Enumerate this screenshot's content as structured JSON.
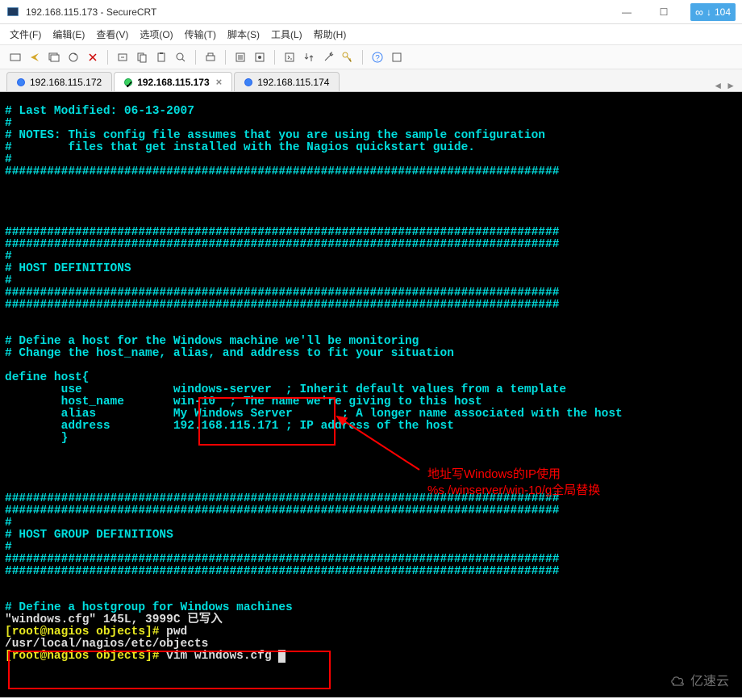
{
  "window": {
    "title": "192.168.115.173 - SecureCRT",
    "badge_number": "104"
  },
  "menu": {
    "file": "文件(F)",
    "edit": "编辑(E)",
    "view": "查看(V)",
    "options": "选项(O)",
    "transfer": "传输(T)",
    "script": "脚本(S)",
    "tools": "工具(L)",
    "help": "帮助(H)"
  },
  "tabs": {
    "t1": "192.168.115.172",
    "t2": "192.168.115.173",
    "t3": "192.168.115.174",
    "close": "×"
  },
  "terminal": {
    "line1": "# Last Modified: 06-13-2007",
    "line2": "#",
    "line3": "# NOTES: This config file assumes that you are using the sample configuration",
    "line4": "#        files that get installed with the Nagios quickstart guide.",
    "line5": "#",
    "hash1": "###############################################################################",
    "hash2": "###############################################################################",
    "hash3": "###############################################################################",
    "hash4": "###############################################################################",
    "line9": "#",
    "line10": "# HOST DEFINITIONS",
    "line11": "#",
    "hash5": "###############################################################################",
    "hash6": "###############################################################################",
    "line14": "# Define a host for the Windows machine we'll be monitoring",
    "line15": "# Change the host_name, alias, and address to fit your situation",
    "define1": "define host{",
    "define2": "        use             windows-server  ; Inherit default values from a template",
    "define3": "        host_name       win-10  ; The name we're giving to this host",
    "define4": "        alias           My Windows Server       ; A longer name associated with the host",
    "define5": "        address         192.168.115.171 ; IP address of the host",
    "define6": "        }",
    "hash7": "###############################################################################",
    "hash8": "###############################################################################",
    "line22": "#",
    "line23": "# HOST GROUP DEFINITIONS",
    "line24": "#",
    "hash9": "###############################################################################",
    "hash10": "###############################################################################",
    "line27": "# Define a hostgroup for Windows machines",
    "status": "\"windows.cfg\" 145L, 3999C 已写入",
    "prompt1_user": "[root@nagios objects]#",
    "prompt1_cmd": " pwd",
    "path": "/usr/local/nagios/etc/objects",
    "prompt2_user": "[root@nagios objects]#",
    "prompt2_cmd": " vim windows.cfg ",
    "cursor": " "
  },
  "annotation": {
    "line1": "地址写Windows的IP使用",
    "line2": "%s /winserver/win-10/g全局替换"
  },
  "watermark": "亿速云"
}
